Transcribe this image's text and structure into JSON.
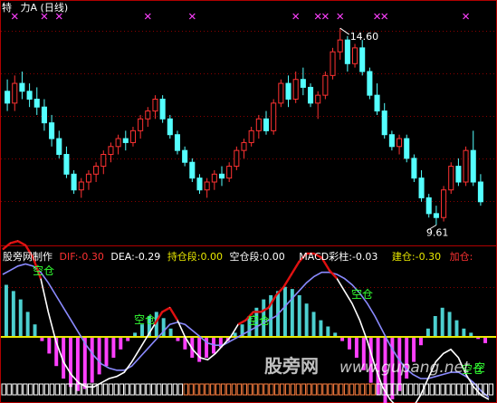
{
  "upper": {
    "title_left": "特",
    "title_name": "力A",
    "title_period": "(日线)",
    "high_label": "14.60",
    "low_label": "9.61",
    "candles": [
      [
        13.0,
        13.3,
        12.5,
        12.7
      ],
      [
        12.7,
        13.4,
        12.5,
        13.2
      ],
      [
        13.2,
        13.5,
        12.8,
        13.0
      ],
      [
        13.0,
        13.2,
        12.6,
        12.8
      ],
      [
        12.8,
        13.1,
        12.4,
        12.6
      ],
      [
        12.6,
        12.8,
        12.0,
        12.2
      ],
      [
        12.2,
        12.4,
        11.6,
        11.8
      ],
      [
        11.8,
        12.0,
        11.3,
        11.4
      ],
      [
        11.4,
        11.6,
        10.8,
        10.9
      ],
      [
        10.9,
        11.0,
        10.4,
        10.5
      ],
      [
        10.5,
        10.8,
        10.3,
        10.7
      ],
      [
        10.7,
        11.0,
        10.5,
        10.9
      ],
      [
        10.9,
        11.2,
        10.7,
        11.1
      ],
      [
        11.1,
        11.5,
        10.9,
        11.4
      ],
      [
        11.4,
        11.7,
        11.2,
        11.6
      ],
      [
        11.6,
        11.9,
        11.4,
        11.8
      ],
      [
        11.8,
        12.0,
        11.5,
        11.7
      ],
      [
        11.7,
        12.1,
        11.6,
        12.0
      ],
      [
        12.0,
        12.4,
        11.8,
        12.3
      ],
      [
        12.3,
        12.6,
        12.1,
        12.5
      ],
      [
        12.5,
        12.9,
        12.3,
        12.8
      ],
      [
        12.8,
        12.9,
        12.2,
        12.3
      ],
      [
        12.3,
        12.4,
        11.8,
        11.9
      ],
      [
        11.9,
        12.0,
        11.4,
        11.5
      ],
      [
        11.5,
        11.6,
        11.1,
        11.2
      ],
      [
        11.2,
        11.3,
        10.7,
        10.8
      ],
      [
        10.8,
        10.9,
        10.4,
        10.5
      ],
      [
        10.5,
        10.8,
        10.3,
        10.7
      ],
      [
        10.7,
        11.0,
        10.5,
        10.9
      ],
      [
        10.9,
        11.1,
        10.6,
        10.8
      ],
      [
        10.8,
        11.2,
        10.7,
        11.1
      ],
      [
        11.1,
        11.6,
        11.0,
        11.5
      ],
      [
        11.5,
        11.8,
        11.3,
        11.7
      ],
      [
        11.7,
        12.1,
        11.6,
        12.0
      ],
      [
        12.0,
        12.4,
        11.8,
        12.3
      ],
      [
        12.3,
        12.5,
        11.9,
        12.0
      ],
      [
        12.0,
        12.8,
        11.9,
        12.7
      ],
      [
        12.7,
        13.3,
        12.6,
        13.2
      ],
      [
        13.2,
        13.4,
        12.6,
        12.8
      ],
      [
        12.8,
        13.5,
        12.7,
        13.3
      ],
      [
        13.3,
        13.6,
        12.9,
        13.1
      ],
      [
        13.1,
        13.2,
        12.6,
        12.7
      ],
      [
        12.7,
        13.0,
        12.3,
        12.9
      ],
      [
        12.9,
        13.5,
        12.8,
        13.4
      ],
      [
        13.4,
        14.1,
        13.3,
        14.0
      ],
      [
        14.0,
        14.6,
        13.8,
        14.3
      ],
      [
        14.3,
        14.4,
        13.5,
        13.7
      ],
      [
        13.7,
        14.2,
        13.6,
        14.1
      ],
      [
        14.1,
        14.3,
        13.4,
        13.5
      ],
      [
        13.5,
        13.6,
        12.8,
        12.9
      ],
      [
        12.9,
        13.2,
        12.4,
        12.5
      ],
      [
        12.5,
        12.7,
        11.8,
        11.9
      ],
      [
        11.9,
        12.0,
        11.5,
        11.6
      ],
      [
        11.6,
        11.9,
        11.4,
        11.8
      ],
      [
        11.8,
        11.9,
        11.2,
        11.3
      ],
      [
        11.3,
        11.4,
        10.7,
        10.8
      ],
      [
        10.8,
        11.0,
        10.2,
        10.3
      ],
      [
        10.3,
        10.4,
        9.8,
        9.9
      ],
      [
        9.9,
        10.1,
        9.61,
        9.8
      ],
      [
        9.8,
        10.6,
        9.7,
        10.5
      ],
      [
        10.5,
        11.2,
        10.4,
        11.1
      ],
      [
        11.1,
        11.3,
        10.6,
        10.7
      ],
      [
        10.7,
        11.6,
        10.6,
        11.5
      ],
      [
        11.5,
        12.0,
        10.6,
        10.7
      ],
      [
        10.7,
        10.9,
        10.1,
        10.2
      ]
    ],
    "signals": [
      1,
      5,
      7,
      19,
      25,
      39,
      42,
      43,
      45,
      50,
      51,
      62
    ]
  },
  "lower": {
    "indicator_name": "股旁网制作",
    "dif_label": "DIF:",
    "dif_value": "-0.30",
    "dea_label": "DEA:",
    "dea_value": "-0.29",
    "hold_label": "持仓段:",
    "hold_value": "0.00",
    "empty_label": "空仓段:",
    "empty_value": "0.00",
    "macd_label": "MACD彩柱:",
    "macd_value": "-0.03",
    "build_label": "建仓:",
    "build_value": "-0.30",
    "add_label": "加仓:",
    "tags": [
      "空仓",
      "空仓",
      "空仓",
      "空仓",
      "空仓",
      "空"
    ],
    "watermark": "股旁网",
    "watermark_url": "www.gupang.net",
    "hist": [
      0.25,
      0.22,
      0.18,
      0.12,
      0.06,
      -0.02,
      -0.08,
      -0.14,
      -0.2,
      -0.24,
      -0.26,
      -0.25,
      -0.22,
      -0.18,
      -0.14,
      -0.1,
      -0.06,
      -0.02,
      0.02,
      0.06,
      0.1,
      0.12,
      0.09,
      0.04,
      -0.02,
      -0.06,
      -0.1,
      -0.12,
      -0.1,
      -0.08,
      -0.05,
      -0.02,
      0.02,
      0.06,
      0.1,
      0.14,
      0.18,
      0.2,
      0.22,
      0.24,
      0.23,
      0.2,
      0.16,
      0.12,
      0.08,
      0.05,
      0.02,
      -0.02,
      -0.06,
      -0.1,
      -0.16,
      -0.22,
      -0.28,
      -0.32,
      -0.3,
      -0.26,
      -0.2,
      -0.12,
      -0.04,
      0.04,
      0.1,
      0.14,
      0.12,
      0.08,
      0.04,
      0.02,
      -0.01,
      -0.03
    ],
    "dif": [
      0.42,
      0.45,
      0.46,
      0.44,
      0.38,
      0.28,
      0.12,
      -0.02,
      -0.12,
      -0.18,
      -0.22,
      -0.24,
      -0.24,
      -0.22,
      -0.2,
      -0.19,
      -0.17,
      -0.12,
      -0.06,
      0.0,
      0.06,
      0.12,
      0.14,
      0.08,
      0.0,
      -0.06,
      -0.1,
      -0.11,
      -0.08,
      -0.04,
      0.0,
      0.06,
      0.08,
      0.12,
      0.12,
      0.14,
      0.2,
      0.24,
      0.3,
      0.36,
      0.4,
      0.4,
      0.38,
      0.32,
      0.28,
      0.22,
      0.16,
      0.08,
      -0.02,
      -0.14,
      -0.24,
      -0.3,
      -0.34,
      -0.36,
      -0.34,
      -0.28,
      -0.2,
      -0.12,
      -0.08,
      -0.06,
      -0.1,
      -0.18,
      -0.24,
      -0.28,
      -0.3
    ],
    "dea": [
      0.3,
      0.32,
      0.34,
      0.35,
      0.34,
      0.31,
      0.26,
      0.2,
      0.14,
      0.08,
      0.02,
      -0.04,
      -0.09,
      -0.13,
      -0.15,
      -0.16,
      -0.16,
      -0.14,
      -0.1,
      -0.06,
      -0.02,
      0.02,
      0.06,
      0.07,
      0.06,
      0.03,
      0.0,
      -0.03,
      -0.04,
      -0.04,
      -0.02,
      0.0,
      0.02,
      0.04,
      0.06,
      0.08,
      0.1,
      0.14,
      0.18,
      0.22,
      0.26,
      0.29,
      0.31,
      0.31,
      0.3,
      0.28,
      0.25,
      0.21,
      0.16,
      0.1,
      0.03,
      -0.04,
      -0.1,
      -0.15,
      -0.18,
      -0.2,
      -0.2,
      -0.19,
      -0.18,
      -0.17,
      -0.17,
      -0.19,
      -0.22,
      -0.26,
      -0.29
    ]
  },
  "colors": {
    "up": "#ff3232",
    "down": "#54ffff",
    "dif_line": "#ffffff",
    "dea_line": "#8a8aff",
    "hold_line": "#e8e800",
    "neg_hist": "#ff40ff",
    "pos_hist": "#4ccfcf",
    "tag": "#33ff33",
    "signal": "#ff40ff"
  }
}
